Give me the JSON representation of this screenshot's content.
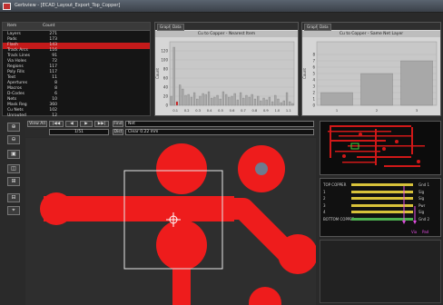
{
  "app": {
    "title": "Gerbview - [ECAD_Layout_Export_Top_Copper]"
  },
  "left_table": {
    "headers": [
      "Item",
      "Count"
    ],
    "rows": [
      {
        "name": "Layers",
        "value": "271",
        "selected": false
      },
      {
        "name": "Pads",
        "value": "173",
        "selected": false
      },
      {
        "name": "Flash",
        "value": "143",
        "selected": true
      },
      {
        "name": "Track Arcs",
        "value": "116",
        "selected": false
      },
      {
        "name": "Track Lines",
        "value": "91",
        "selected": false
      },
      {
        "name": "Via Holes",
        "value": "72",
        "selected": false
      },
      {
        "name": "Regions",
        "value": "117",
        "selected": false
      },
      {
        "name": "Poly Fills",
        "value": "117",
        "selected": false
      },
      {
        "name": "Text",
        "value": "11",
        "selected": false
      },
      {
        "name": "Apertures",
        "value": "8",
        "selected": false
      },
      {
        "name": "Macros",
        "value": "8",
        "selected": false
      },
      {
        "name": "D-Codes",
        "value": "6",
        "selected": false
      },
      {
        "name": "Nets",
        "value": "10",
        "selected": false
      },
      {
        "name": "Mask Reg",
        "value": "360",
        "selected": false
      },
      {
        "name": "Cu Nets",
        "value": "102",
        "selected": false
      },
      {
        "name": "Unrouted",
        "value": "12",
        "selected": false
      }
    ]
  },
  "chart_left": {
    "tabs": [
      "Graph",
      "Data"
    ],
    "title": "Cu to Copper - Nearest Item",
    "ylabel": "Count"
  },
  "chart_right": {
    "tabs": [
      "Graph",
      "Data"
    ],
    "title": "Cu to Copper - Same Net Layer",
    "ylabel": "Count"
  },
  "chart_data": [
    {
      "type": "bar",
      "title": "Cu to Copper - Nearest Item",
      "ylabel": "Count",
      "ylim": [
        0,
        140
      ],
      "yticks": [
        "0",
        "20",
        "40",
        "60",
        "80",
        "100",
        "120"
      ],
      "xticks": [
        "0.1",
        "0.2",
        "0.3",
        "0.4",
        "0.5",
        "0.6",
        "0.7",
        "0.8",
        "0.9",
        "1.0",
        "1.1"
      ],
      "values": [
        20,
        128,
        8,
        45,
        36,
        22,
        24,
        18,
        28,
        14,
        20,
        26,
        24,
        30,
        16,
        18,
        22,
        14,
        30,
        24,
        18,
        20,
        26,
        12,
        28,
        16,
        22,
        18,
        24,
        14,
        20,
        10,
        16,
        12,
        18,
        8,
        22,
        14,
        6,
        10,
        28,
        8,
        4
      ],
      "highlight_index": 2,
      "bar_color": "#a8a8a8",
      "highlight_color": "#e01010"
    },
    {
      "type": "bar",
      "title": "Cu to Copper - Same Net Layer",
      "ylabel": "Count",
      "ylim": [
        0,
        10
      ],
      "yticks": [
        "0",
        "1",
        "2",
        "3",
        "4",
        "5",
        "6",
        "7",
        "8"
      ],
      "categories": [
        "1",
        "2",
        "3"
      ],
      "values": [
        2,
        5,
        7
      ],
      "bar_color": "#a8a8a8"
    }
  ],
  "navigation": {
    "view_all": "View All",
    "first": "|◀◀",
    "prev": "◀",
    "next": "▶",
    "last": "▶▶|",
    "counter": "1/51",
    "filter_label": "Find",
    "filter_value": "Net",
    "field2_label": "Dist",
    "field2_value": "Clear 0.22 mm"
  },
  "vertical_tools": [
    "⊕",
    "⊖",
    "▣",
    "◫",
    "⊞",
    "⊟",
    "⌖"
  ],
  "stackup": {
    "layers": [
      {
        "label": "TOP COPPER",
        "right": "Gnd 1",
        "color": "#d8c23a"
      },
      {
        "label": "1",
        "right": "Sig",
        "color": "#d8c23a"
      },
      {
        "label": "2",
        "right": "Sig",
        "color": "#d8c23a"
      },
      {
        "label": "3",
        "right": "Pwr",
        "color": "#d8c23a"
      },
      {
        "label": "4",
        "right": "Sig",
        "color": "#d8c23a"
      },
      {
        "label": "BOTTOM COPPER",
        "right": "Gnd 2",
        "color": "#4caf50"
      }
    ],
    "legend": [
      "Via",
      "Pad"
    ]
  }
}
